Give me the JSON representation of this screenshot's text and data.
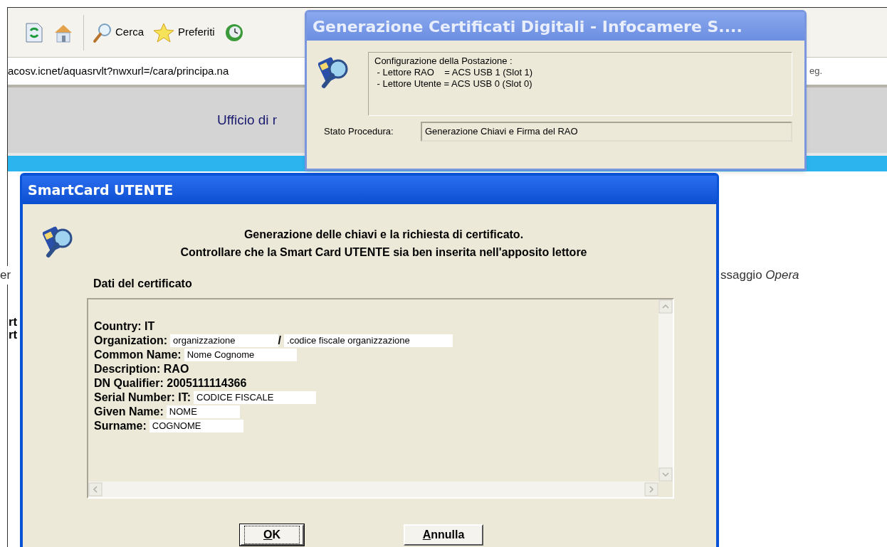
{
  "browser": {
    "toolbar": [
      {
        "kind": "refresh"
      },
      {
        "kind": "home"
      },
      {
        "kind": "search",
        "label": "Cerca"
      },
      {
        "kind": "favorites",
        "label": "Preferiti"
      },
      {
        "kind": "history"
      }
    ],
    "address": "acosv.icnet/aquasrvlt?nwxurl=/cara/principa.na",
    "address_tail": "eg.",
    "page_heading": "Ufficio di r",
    "fragments_left": [
      "er",
      "rt",
      "rt"
    ],
    "fragment_right": "ssaggio *Opera*"
  },
  "status_dialog": {
    "title": "Generazione Certificati Digitali - Infocamere S....",
    "config_lines": [
      "Configurazione della Postazione :",
      " - Lettore RAO    = ACS USB 1 (Slot 1)",
      " - Lettore Utente = ACS USB 0 (Slot 0)"
    ],
    "status_label": "Stato Procedura:",
    "status_value": "Generazione Chiavi e Firma del RAO"
  },
  "card_dialog": {
    "title": "SmartCard UTENTE",
    "message_lines": [
      "Generazione delle chiavi e la richiesta di certificato.",
      "Controllare che la Smart Card UTENTE sia ben inserita nell'apposito lettore"
    ],
    "section_label": "Dati del certificato",
    "certificate_lines": [
      {
        "segments": [
          {
            "kind": "label",
            "text": "Country: IT"
          }
        ]
      },
      {
        "segments": [
          {
            "kind": "label",
            "text": "Organization:"
          },
          {
            "kind": "masked",
            "text": "organizzazione"
          },
          {
            "kind": "label",
            "text": "/"
          },
          {
            "kind": "masked",
            "text": ".codice fiscale organizzazione"
          }
        ]
      },
      {
        "segments": [
          {
            "kind": "label",
            "text": "Common Name:"
          },
          {
            "kind": "masked",
            "text": "Nome Cognome"
          }
        ]
      },
      {
        "segments": [
          {
            "kind": "label",
            "text": "Description: RAO"
          }
        ]
      },
      {
        "segments": [
          {
            "kind": "label",
            "text": "DN Qualifier: 2005111114366"
          }
        ]
      },
      {
        "segments": [
          {
            "kind": "label",
            "text": "Serial Number: IT:"
          },
          {
            "kind": "masked",
            "text": "CODICE FISCALE"
          }
        ]
      },
      {
        "segments": [
          {
            "kind": "label",
            "text": "Given Name:"
          },
          {
            "kind": "masked",
            "text": "NOME"
          }
        ]
      },
      {
        "segments": [
          {
            "kind": "label",
            "text": "Surname:"
          },
          {
            "kind": "masked",
            "text": "COGNOME"
          }
        ]
      }
    ],
    "buttons": [
      {
        "label": "OK",
        "focused": true
      },
      {
        "label": "Annulla",
        "focused": false
      }
    ]
  }
}
